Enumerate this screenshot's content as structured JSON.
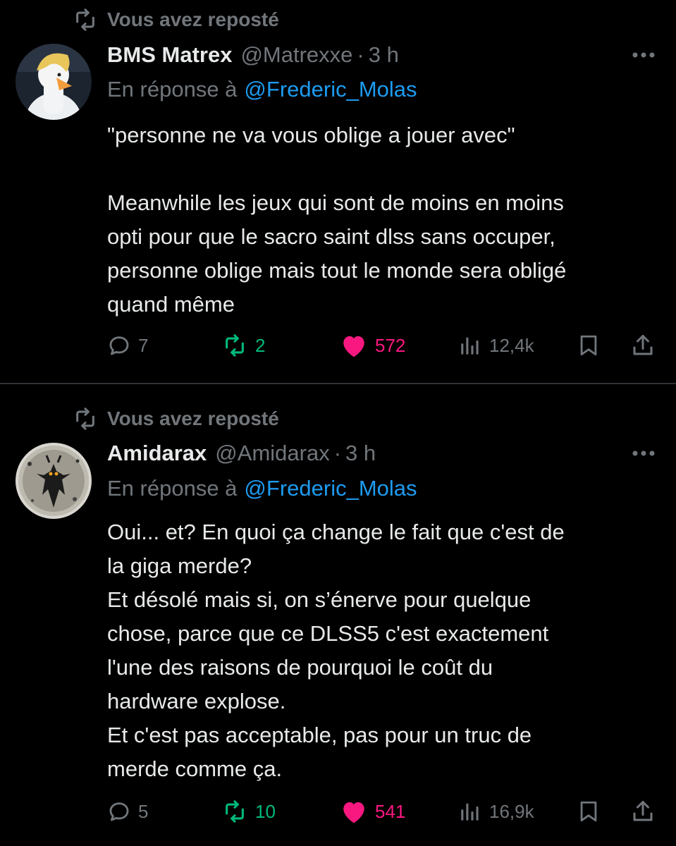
{
  "colors": {
    "background": "#000000",
    "text": "#e7e9ea",
    "muted": "#71767b",
    "link": "#1d9bf0",
    "repost_green": "#00ba7c",
    "like_pink": "#f91880",
    "divider": "#2f3336"
  },
  "tweets": [
    {
      "repost_label": "Vous avez reposté",
      "author": {
        "name": "BMS Matrex",
        "handle": "@Matrexxe",
        "dot": "·",
        "time": "3 h",
        "avatar_icon": "duck-avatar"
      },
      "reply_prefix": "En réponse à",
      "reply_to": "@Frederic_Molas",
      "paragraphs": [
        "\"personne ne va vous oblige a jouer avec\"",
        "",
        "Meanwhile les jeux qui sont de moins en moins",
        "opti pour que le sacro saint dlss sans occuper,",
        "personne oblige mais tout le monde sera obligé",
        "quand même"
      ],
      "stats": {
        "replies": "7",
        "reposts": "2",
        "likes": "572",
        "views": "12,4k"
      }
    },
    {
      "repost_label": "Vous avez reposté",
      "author": {
        "name": "Amidarax",
        "handle": "@Amidarax",
        "dot": "·",
        "time": "3 h",
        "avatar_icon": "dark-creature-avatar"
      },
      "reply_prefix": "En réponse à",
      "reply_to": "@Frederic_Molas",
      "paragraphs": [
        "Oui... et? En quoi ça change le fait que c'est de",
        "la giga merde?",
        "Et désolé mais si, on s’énerve pour quelque",
        "chose, parce que ce DLSS5 c'est exactement",
        "l'une des raisons de pourquoi le coût du",
        "hardware explose.",
        "Et c'est pas acceptable, pas pour un truc de",
        "merde comme ça."
      ],
      "stats": {
        "replies": "5",
        "reposts": "10",
        "likes": "541",
        "views": "16,9k"
      }
    }
  ]
}
